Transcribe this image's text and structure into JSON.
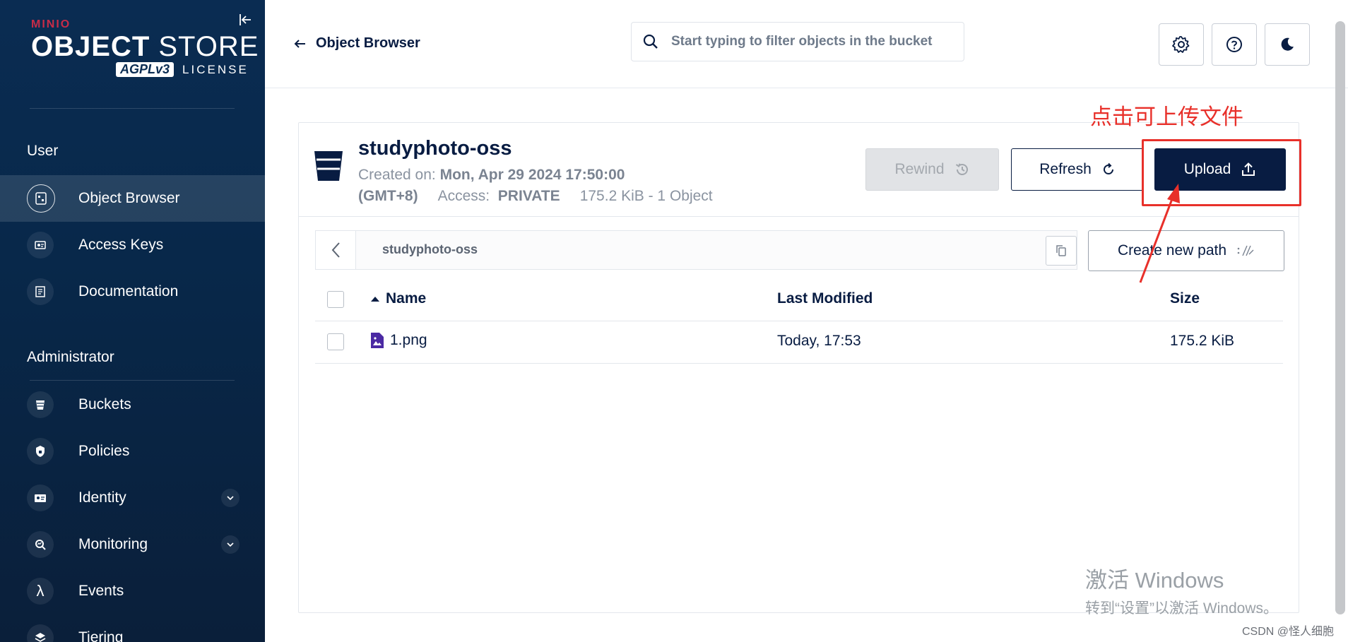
{
  "sidebar": {
    "logo": {
      "brand": "MINIO",
      "product_bold": "OBJECT",
      "product_thin": "STORE",
      "license_badge": "AGPLv3",
      "license": "LICENSE"
    },
    "sections": [
      {
        "title": "User"
      },
      {
        "title": "Administrator"
      }
    ],
    "items": [
      {
        "label": "Object Browser",
        "icon": "object-browser-icon"
      },
      {
        "label": "Access Keys",
        "icon": "access-keys-icon"
      },
      {
        "label": "Documentation",
        "icon": "documentation-icon"
      },
      {
        "label": "Buckets",
        "icon": "buckets-icon"
      },
      {
        "label": "Policies",
        "icon": "policies-icon"
      },
      {
        "label": "Identity",
        "icon": "identity-icon"
      },
      {
        "label": "Monitoring",
        "icon": "monitoring-icon"
      },
      {
        "label": "Events",
        "icon": "lambda-icon",
        "glyph": "λ"
      },
      {
        "label": "Tiering",
        "icon": "tiering-icon"
      }
    ]
  },
  "header": {
    "back_label": "Object Browser",
    "search_placeholder": "Start typing to filter objects in the bucket"
  },
  "bucket": {
    "name": "studyphoto-oss",
    "created_label": "Created on:",
    "created_value": "Mon, Apr 29 2024 17:50:00",
    "timezone": "(GMT+8)",
    "access_label": "Access:",
    "access_value": "PRIVATE",
    "usage": "175.2 KiB - 1 Object"
  },
  "actions": {
    "rewind": "Rewind",
    "refresh": "Refresh",
    "upload": "Upload",
    "create_path": "Create new path"
  },
  "path": {
    "current": "studyphoto-oss"
  },
  "table": {
    "columns": [
      "Name",
      "Last Modified",
      "Size"
    ],
    "rows": [
      {
        "name": "1.png",
        "modified": "Today, 17:53",
        "size": "175.2 KiB"
      }
    ]
  },
  "annotation": {
    "text": "点击可上传文件",
    "color": "#e8302a"
  },
  "watermark": {
    "line1": "激活 Windows",
    "line2": "转到“设置”以激活 Windows。"
  },
  "credit": "CSDN @怪人细胞",
  "colors": {
    "sidebar_bg": "#0a2c52",
    "primary": "#081c42",
    "annotation": "#e8302a"
  }
}
